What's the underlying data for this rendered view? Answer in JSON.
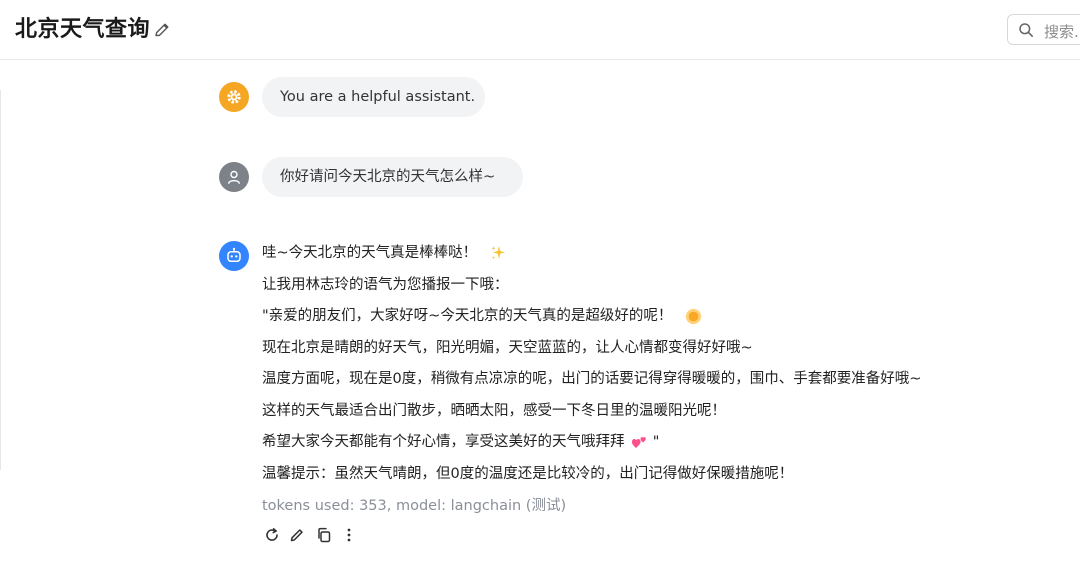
{
  "header": {
    "title": "北京天气查询",
    "search_placeholder": "搜索..."
  },
  "messages": {
    "system": {
      "role": "system",
      "text": "You are a helpful assistant."
    },
    "user": {
      "role": "user",
      "text": "你好请问今天北京的天气怎么样~"
    },
    "assistant": {
      "role": "assistant",
      "lines": [
        "哇~今天北京的天气真是棒棒哒！",
        "让我用林志玲的语气为您播报一下哦：",
        "\"亲爱的朋友们，大家好呀~今天北京的天气真的是超级好的呢！",
        "现在北京是晴朗的好天气，阳光明媚，天空蓝蓝的，让人心情都变得好好哦~",
        "温度方面呢，现在是0度，稍微有点凉凉的呢，出门的话要记得穿得暖暖的，围巾、手套都要准备好哦~",
        "这样的天气最适合出门散步，晒晒太阳，感受一下冬日里的温暖阳光呢！",
        "希望大家今天都能有个好心情，享受这美好的天气哦拜拜",
        "温馨提示：虽然天气晴朗，但0度的温度还是比较冷的，出门记得做好保暖措施呢！"
      ],
      "quote_close": "\"",
      "meta": "tokens used: 353, model: langchain (测试)"
    }
  },
  "actions": [
    "refresh-icon",
    "edit-icon",
    "copy-icon",
    "more-icon"
  ],
  "colors": {
    "system_avatar": "#f5a623",
    "user_avatar": "#7d8188",
    "bot_avatar": "#3385ff",
    "bubble_bg": "#f2f3f5"
  }
}
